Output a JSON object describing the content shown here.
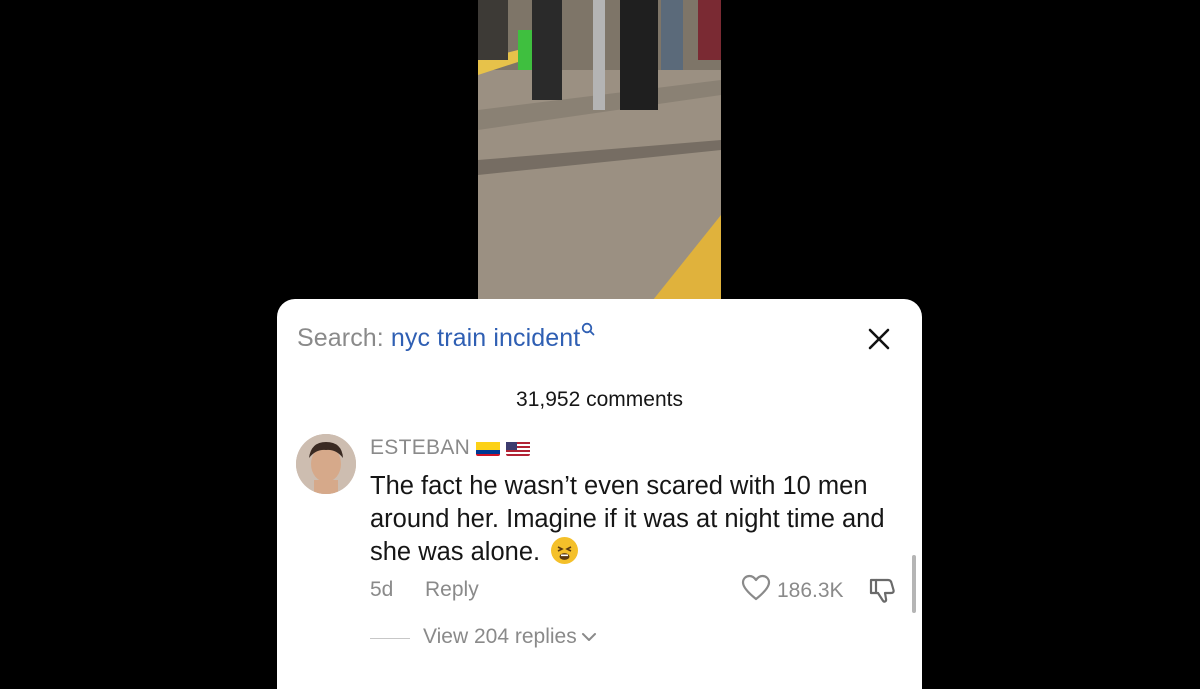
{
  "search": {
    "prefix": "Search:",
    "query": "nyc train incident"
  },
  "comments": {
    "count_label": "31,952 comments"
  },
  "comment": {
    "username": "ESTEBAN",
    "text": "The fact he wasn’t even scared with 10 men around her. Imagine if it was at night time and she was alone.",
    "time": "5d",
    "reply_label": "Reply",
    "likes": "186.3K",
    "view_replies": "View 204 replies"
  },
  "icons": {
    "search": "magnifier-icon",
    "close": "close-icon",
    "like": "heart-icon",
    "dislike": "thumbs-down-icon",
    "chevron": "chevron-down-icon",
    "emoji": "tired-face-emoji"
  },
  "colors": {
    "link": "#2f5fb3",
    "muted": "#8a8a8a",
    "text": "#161616"
  }
}
